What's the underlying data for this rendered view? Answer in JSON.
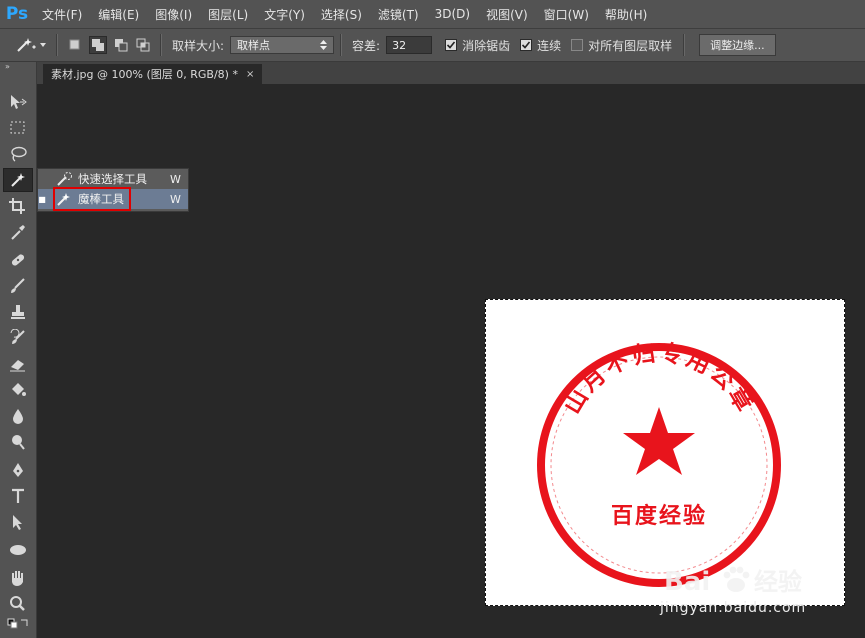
{
  "app": {
    "logo": "Ps"
  },
  "menu": [
    "文件(F)",
    "编辑(E)",
    "图像(I)",
    "图层(L)",
    "文字(Y)",
    "选择(S)",
    "滤镜(T)",
    "3D(D)",
    "视图(V)",
    "窗口(W)",
    "帮助(H)"
  ],
  "options": {
    "sample_size_label": "取样大小:",
    "sample_size_value": "取样点",
    "tolerance_label": "容差:",
    "tolerance_value": "32",
    "antialias_label": "消除锯齿",
    "antialias_checked": true,
    "contiguous_label": "连续",
    "contiguous_checked": true,
    "all_layers_label": "对所有图层取样",
    "all_layers_checked": false,
    "refine_edge_label": "调整边缘..."
  },
  "document": {
    "tab_title": "素材.jpg @ 100% (图层 0, RGB/8) *",
    "close_glyph": "×"
  },
  "toolbar": {
    "collapse_glyph": "»"
  },
  "flyout": {
    "items": [
      {
        "label": "快速选择工具",
        "shortcut": "W",
        "selected": false
      },
      {
        "label": "魔棒工具",
        "shortcut": "W",
        "selected": true
      }
    ]
  },
  "stamp": {
    "arc_text": "山月不归专用公章",
    "bottom_text": "百度经验",
    "color": "#e8141c"
  },
  "watermark": {
    "logo_text": "Bai",
    "logo_text2": "经验",
    "url": "jingyan.baidu.com"
  },
  "colors": {
    "accent": "#2da8ff",
    "selection_highlight": "#6c7c94",
    "annotation_red": "#e00000"
  }
}
